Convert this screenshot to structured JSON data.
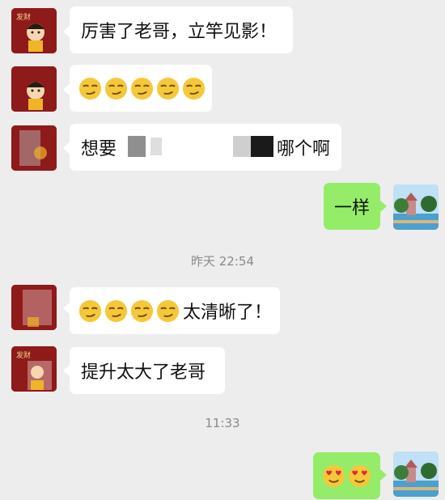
{
  "messages": [
    {
      "side": "left",
      "text": "厉害了老哥，立竿见影！",
      "emoji_count": 0
    },
    {
      "side": "left",
      "text": "",
      "emoji_count": 5,
      "emoji": "smirk-emoji"
    },
    {
      "side": "left",
      "text_start": "想要",
      "text_end": "哪个啊",
      "redacted": true
    },
    {
      "side": "right",
      "text": "一样"
    },
    {
      "side": "left",
      "text": "太清晰了！",
      "emoji_count": 4,
      "emoji": "smirk-emoji"
    },
    {
      "side": "left",
      "text": "提升太大了老哥"
    },
    {
      "side": "right",
      "text": "",
      "emoji_count": 2,
      "emoji": "heart-eyes-emoji"
    }
  ],
  "timestamps": {
    "first": "昨天 22:54",
    "second": "11:33"
  },
  "avatar_left_label": "发财",
  "colors": {
    "background": "#ededed",
    "incoming_bubble": "#ffffff",
    "outgoing_bubble": "#95ec69",
    "timestamp_text": "#8a8a8a",
    "avatar_left": "#8e1a1a"
  }
}
